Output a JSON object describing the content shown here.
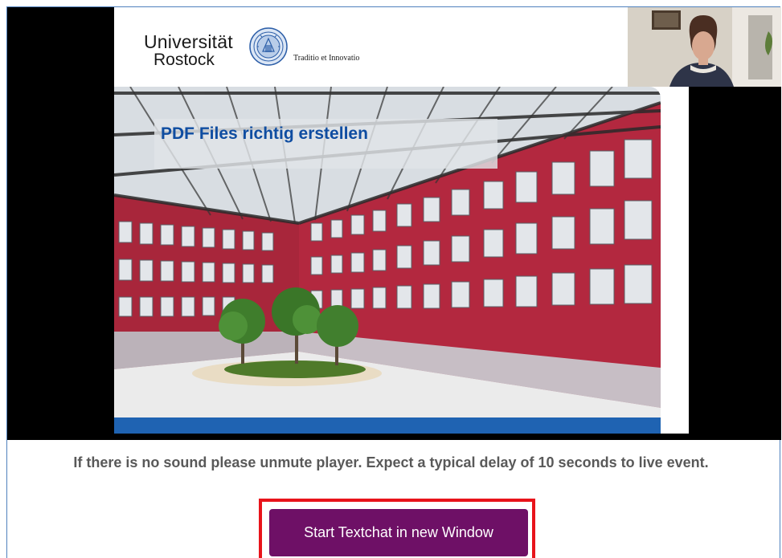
{
  "player": {
    "slide": {
      "logo_line1": "Universität",
      "logo_line2": "Rostock",
      "motto": "Traditio et Innovatio",
      "title": "PDF Files richtig erstellen"
    }
  },
  "notice_text": "If there is no sound please unmute player. Expect a typical delay of 10 seconds to live event.",
  "chat_button_label": "Start Textchat in new Window",
  "colors": {
    "slide_title": "#0f4da1",
    "slide_bar": "#1f63b2",
    "button_bg": "#6e1066",
    "highlight_border": "#e8141b",
    "building_red": "#b3283f"
  }
}
